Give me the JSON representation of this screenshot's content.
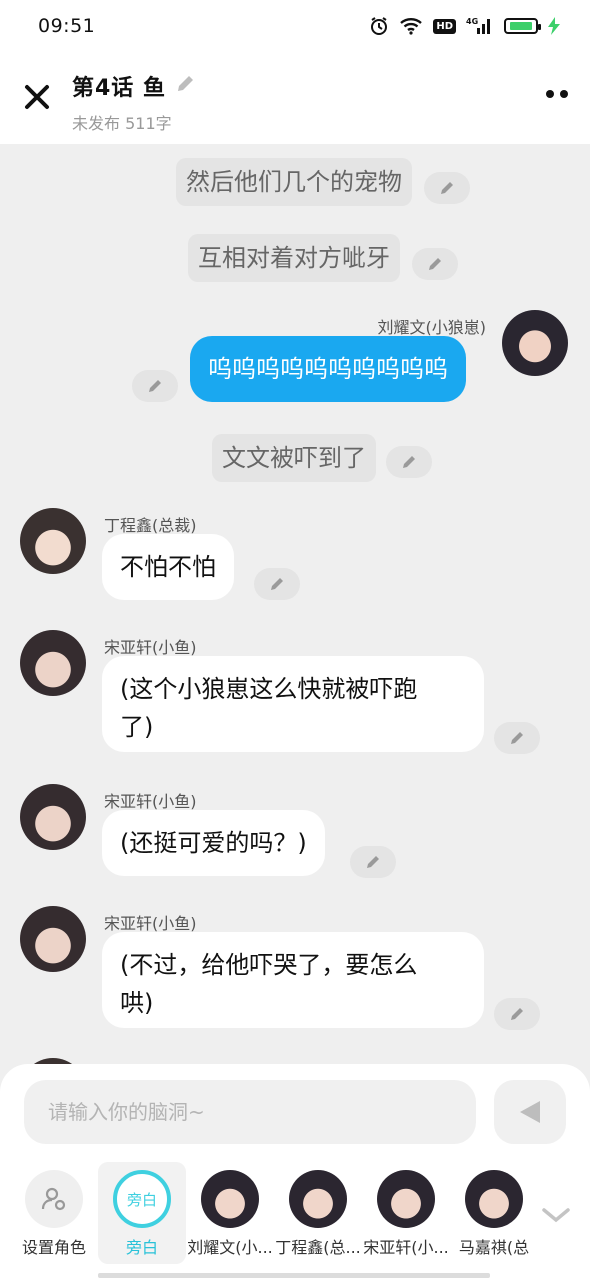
{
  "status_bar": {
    "time": "09:51",
    "hd": "HD",
    "network": "4G",
    "battery_level": 0.85
  },
  "header": {
    "title": "第4话 鱼",
    "subtitle": "未发布 511字"
  },
  "messages": [
    {
      "type": "narration",
      "text": "然后他们几个的宠物"
    },
    {
      "type": "narration",
      "text": "互相对着对方呲牙"
    },
    {
      "type": "me",
      "speaker": "刘耀文(小狼崽)",
      "text": "呜呜呜呜呜呜呜呜呜呜"
    },
    {
      "type": "narration",
      "text": "文文被吓到了"
    },
    {
      "type": "other",
      "speaker": "丁程鑫(总裁)",
      "text": "不怕不怕"
    },
    {
      "type": "other",
      "speaker": "宋亚轩(小鱼)",
      "text_line1": "(这个小狼崽这么快就被吓跑",
      "text_line2": "了)"
    },
    {
      "type": "other",
      "speaker": "宋亚轩(小鱼)",
      "text": "(还挺可爱的吗？)"
    },
    {
      "type": "other",
      "speaker": "宋亚轩(小鱼)",
      "text_line1": "(不过，给他吓哭了，要怎么",
      "text_line2": "哄)"
    }
  ],
  "composer": {
    "placeholder": "请输入你的脑洞~"
  },
  "roles": [
    {
      "label": "设置角色"
    },
    {
      "label": "旁白",
      "icon_text": "旁白",
      "active": true
    },
    {
      "label": "刘耀文(小..."
    },
    {
      "label": "丁程鑫(总..."
    },
    {
      "label": "宋亚轩(小..."
    },
    {
      "label": "马嘉祺(总"
    }
  ],
  "colors": {
    "accent_blue": "#1aa8f0",
    "narration_cyan": "#3fd0e0",
    "battery_green": "#3ccf6a"
  }
}
